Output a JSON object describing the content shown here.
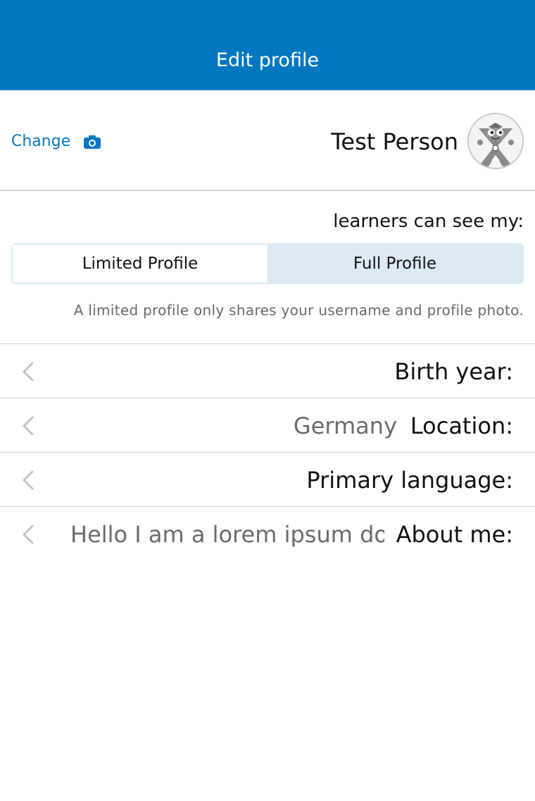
{
  "navbar": {
    "title": "Edit profile"
  },
  "profile": {
    "change_label": "Change",
    "camera_icon": "camera-icon",
    "user_name": "Test Person",
    "avatar_icon": "mascot-avatar"
  },
  "visibility": {
    "heading": "learners can see my:",
    "options": [
      {
        "label": "Limited Profile",
        "selected": false
      },
      {
        "label": "Full Profile",
        "selected": true
      }
    ],
    "hint": "A limited profile only shares your username and profile photo."
  },
  "fields": [
    {
      "label": "Birth year:",
      "value": ""
    },
    {
      "label": "Location:",
      "value": "Germany"
    },
    {
      "label": "Primary language:",
      "value": ""
    },
    {
      "label": "About me:",
      "value": "Hello I am a lorem ipsum do…"
    }
  ],
  "colors": {
    "primary": "#0077c0",
    "selected_segment": "#dbeaf4",
    "value_text": "#6b6b6b"
  }
}
